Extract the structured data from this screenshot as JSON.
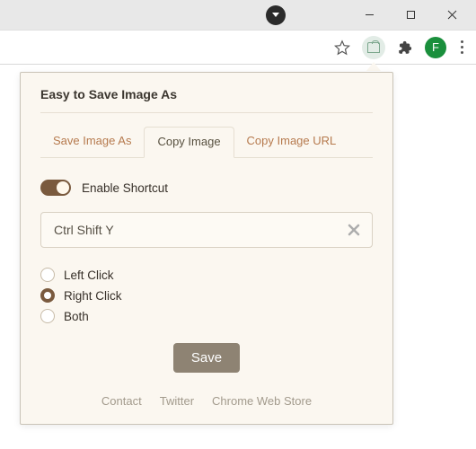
{
  "window": {
    "avatar_initial": "F"
  },
  "popup": {
    "title": "Easy to Save Image As",
    "tabs": [
      {
        "label": "Save Image As",
        "active": false
      },
      {
        "label": "Copy Image",
        "active": true
      },
      {
        "label": "Copy Image URL",
        "active": false
      }
    ],
    "toggle": {
      "label": "Enable Shortcut",
      "on": true
    },
    "shortcut": {
      "value": "Ctrl Shift Y",
      "placeholder": "Ctrl Shift Y"
    },
    "radios": {
      "options": [
        {
          "label": "Left Click",
          "checked": false
        },
        {
          "label": "Right Click",
          "checked": true
        },
        {
          "label": "Both",
          "checked": false
        }
      ]
    },
    "save_label": "Save",
    "footer": {
      "contact": "Contact",
      "twitter": "Twitter",
      "store": "Chrome Web Store"
    }
  }
}
